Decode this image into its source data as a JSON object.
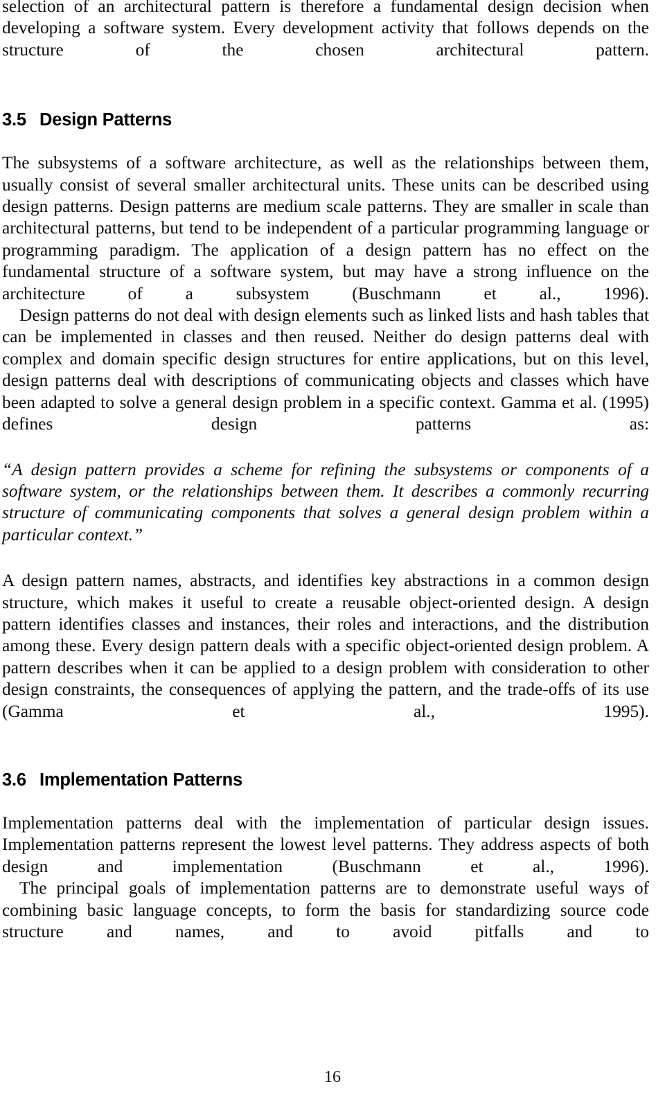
{
  "document": {
    "page_number": "16",
    "body_text_color": "#0d0d0d",
    "background_color": "#ffffff"
  },
  "content": {
    "intro_paragraph": "selection of an architectural pattern is therefore a fundamental design decision when developing a software system. Every development activity that follows depends on the structure of the chosen architectural pattern.",
    "section_3_5": {
      "number": "3.5",
      "title": "Design Patterns",
      "paragraphs": [
        "The subsystems of a software architecture, as well as the relationships between them, usually consist of several smaller architectural units. These units can be described using design patterns. Design patterns are medium scale patterns. They are smaller in scale than architectural patterns, but tend to be independent of a particular programming language or programming paradigm. The application of a design pattern has no effect on the fundamental structure of a software system, but may have a strong influence on the architecture of a subsystem (Buschmann et al., 1996).",
        "Design patterns do not deal with design elements such as linked lists and hash tables that can be implemented in classes and then reused. Neither do design patterns deal with complex and domain specific design structures for entire applications, but on this level, design patterns deal with descriptions of communicating objects and classes which have been adapted to solve a general design problem in a specific context. Gamma et al. (1995) defines design patterns as:"
      ],
      "quote": "“A design pattern provides a scheme for refining the subsystems or components of a software system, or the relationships between them. It describes a commonly recurring structure of communicating components that solves a general design problem within a particular context.”",
      "paragraph_after_quote": "A design pattern names, abstracts, and identifies key abstractions in a common design structure, which makes it useful to create a reusable object-oriented design. A design pattern identifies classes and instances, their roles and interactions, and the distribution among these. Every design pattern deals with a specific object-oriented design problem. A pattern describes when it can be applied to a design problem with consideration to other design constraints, the consequences of applying the pattern, and the trade-offs of its use (Gamma et al., 1995)."
    },
    "section_3_6": {
      "number": "3.6",
      "title": "Implementation Patterns",
      "paragraphs": [
        "Implementation patterns deal with the implementation of particular design issues. Implementation patterns represent the lowest level patterns. They address aspects of both design and implementation (Buschmann et al., 1996).",
        "The principal goals of implementation patterns are to demonstrate useful ways of combining basic language concepts, to form the basis for standardizing source code structure and names, and to avoid pitfalls and to"
      ]
    }
  }
}
